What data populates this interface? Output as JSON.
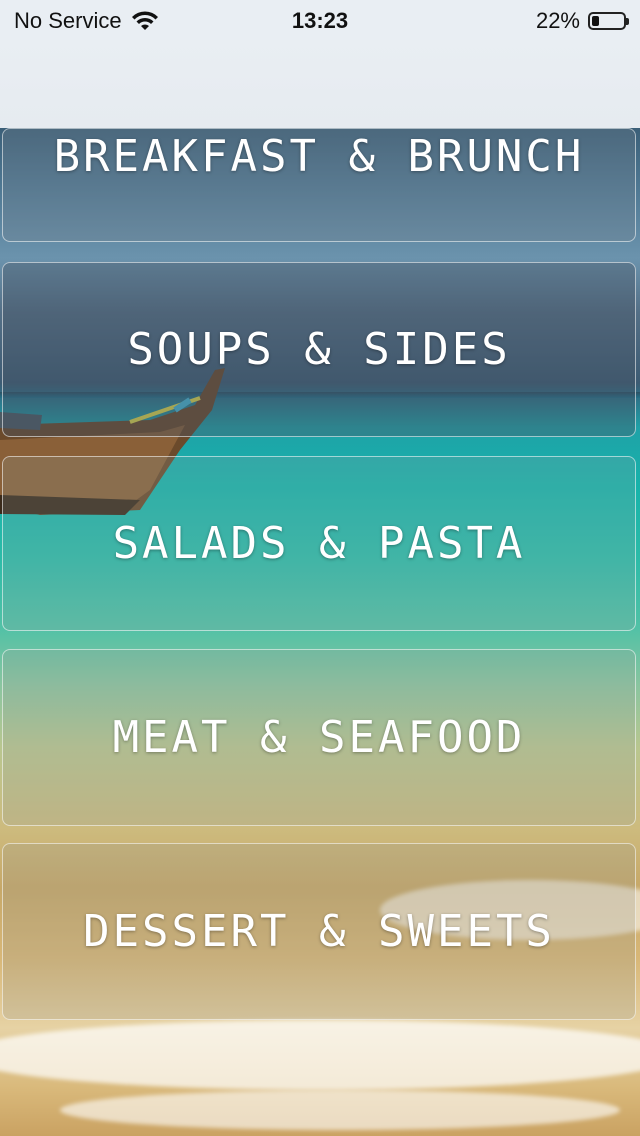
{
  "status_bar": {
    "carrier": "No Service",
    "time": "13:23",
    "battery_percent": "22%",
    "battery_level": 0.22,
    "wifi_icon": "wifi-icon",
    "battery_icon": "battery-icon"
  },
  "categories": [
    {
      "label": "BREAKFAST & BRUNCH"
    },
    {
      "label": "SOUPS & SIDES"
    },
    {
      "label": "SALADS & PASTA"
    },
    {
      "label": "MEAT & SEAFOOD"
    },
    {
      "label": "DESSERT & SWEETS"
    }
  ],
  "colors": {
    "label_text": "#ffffff",
    "nav_background": "#e9eef3"
  }
}
